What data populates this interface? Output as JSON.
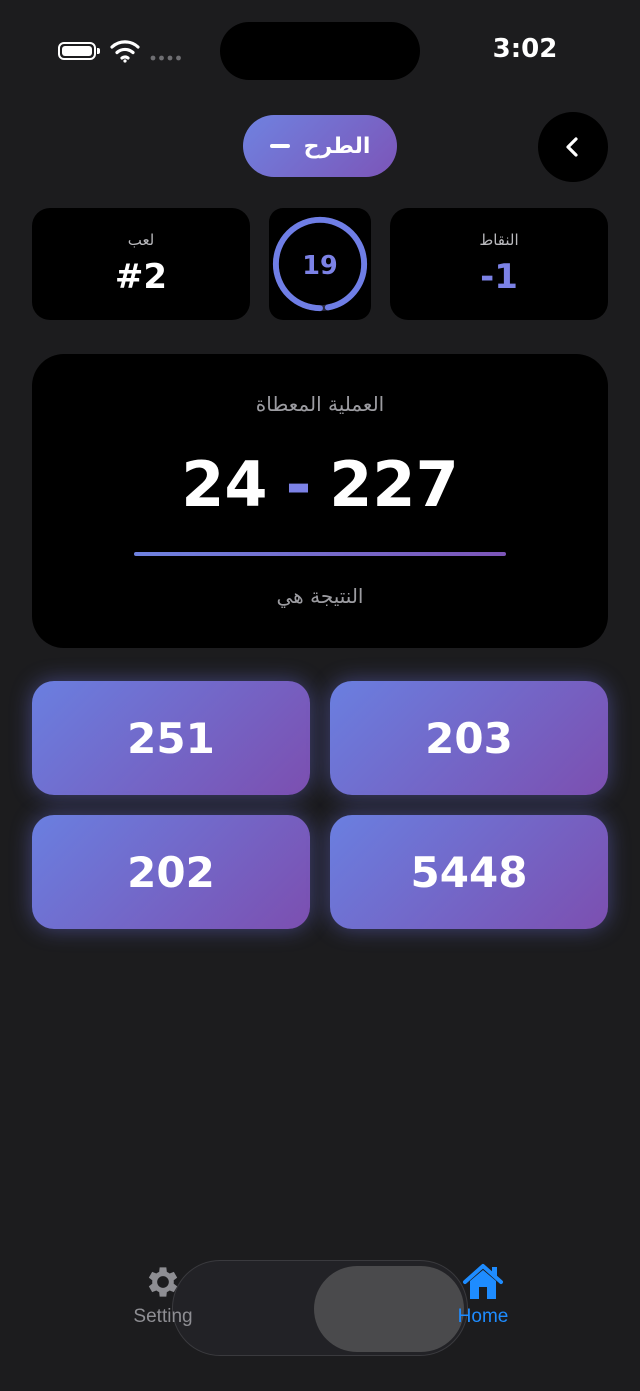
{
  "status": {
    "time": "3:02"
  },
  "header": {
    "operation_label": "الطرح"
  },
  "stats": {
    "points_label": "النقاط",
    "points_value": "-1",
    "timer_value": "19",
    "timer_progress": 0.97,
    "game_label": "لعب",
    "game_value": "#2"
  },
  "question": {
    "label": "العملية المعطاة",
    "left_operand": "24",
    "operator": "-",
    "right_operand": "227",
    "result_label": "النتيجة هي"
  },
  "answers": [
    "251",
    "203",
    "202",
    "5448"
  ],
  "tabbar": {
    "setting_label": "Setting",
    "home_label": "Home",
    "active_tab": "home"
  },
  "colors": {
    "accent_start": "#6f82e0",
    "accent_end": "#7c55b8",
    "timer_ring": "#6f7ee6",
    "active_tab": "#1e8cff",
    "inactive_tab": "#8e8e93"
  }
}
